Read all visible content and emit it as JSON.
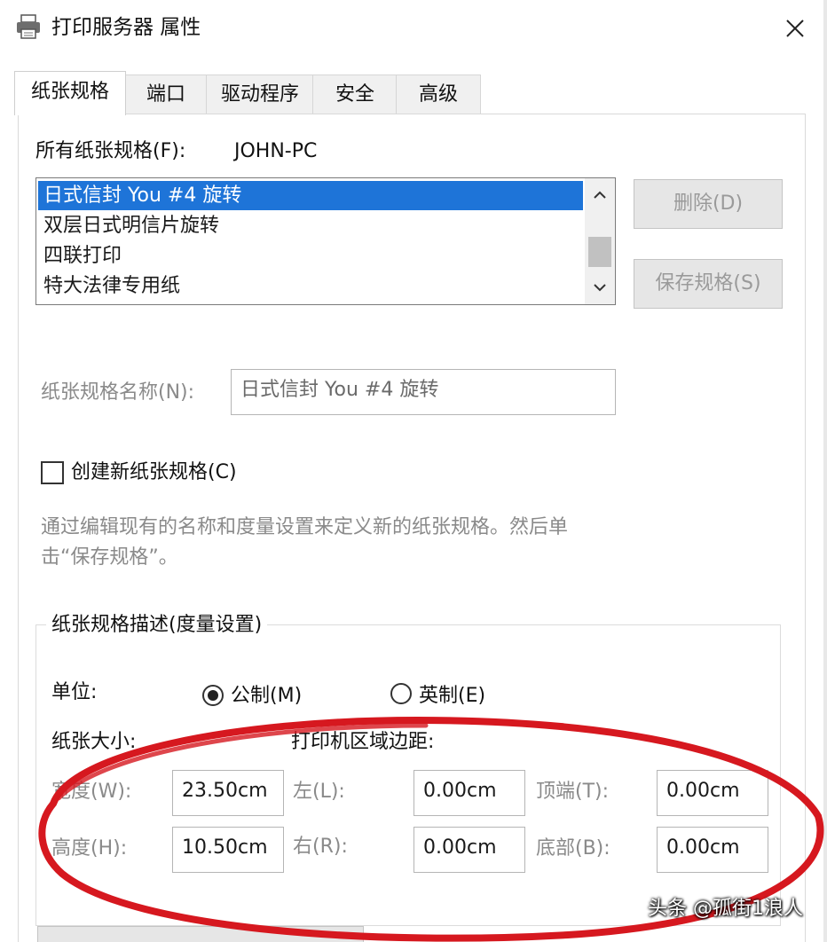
{
  "window": {
    "title": "打印服务器 属性",
    "icon": "printer-icon",
    "close_icon": "close-icon"
  },
  "tabs": [
    {
      "label": "纸张规格",
      "active": true
    },
    {
      "label": "端口",
      "active": false
    },
    {
      "label": "驱动程序",
      "active": false
    },
    {
      "label": "安全",
      "active": false
    },
    {
      "label": "高级",
      "active": false
    }
  ],
  "forms": {
    "all_forms_label": "所有纸张规格(F):",
    "server_name": "JOHN-PC",
    "list_items": [
      {
        "label": "日式信封 You #4 旋转",
        "selected": true
      },
      {
        "label": "双层日式明信片旋转",
        "selected": false
      },
      {
        "label": "四联打印",
        "selected": false
      },
      {
        "label": "特大法律专用纸",
        "selected": false
      }
    ],
    "delete_button": "删除(D)",
    "save_button": "保存规格(S)",
    "form_name_label": "纸张规格名称(N):",
    "form_name_value": "日式信封 You #4 旋转",
    "create_new_label": "创建新纸张规格(C)",
    "create_new_checked": false,
    "hint_line1": "通过编辑现有的名称和度量设置来定义新的纸张规格。然后单",
    "hint_line2": "击“保存规格”。",
    "group_title": "纸张规格描述(度量设置)",
    "units_label": "单位:",
    "metric_label": "公制(M)",
    "english_label": "英制(E)",
    "unit_selected": "metric",
    "paper_size_label": "纸张大小:",
    "margins_label": "打印机区域边距:",
    "width_label": "宽度(W):",
    "width_value": "23.50cm",
    "height_label": "高度(H):",
    "height_value": "10.50cm",
    "left_label": "左(L):",
    "left_value": "0.00cm",
    "right_label": "右(R):",
    "right_value": "0.00cm",
    "top_label": "顶端(T):",
    "top_value": "0.00cm",
    "bottom_label": "底部(B):",
    "bottom_value": "0.00cm"
  },
  "watermark": "头条 @孤街1浪人",
  "colors": {
    "selection": "#1e74d8",
    "annotation": "#d6181f",
    "disabled_text": "#8a8a8a"
  }
}
